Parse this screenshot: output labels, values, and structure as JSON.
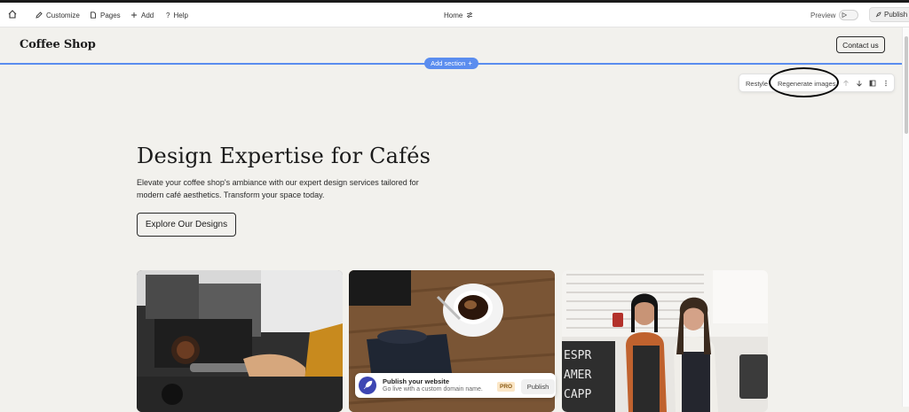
{
  "editor": {
    "nav": {
      "customize": "Customize",
      "pages": "Pages",
      "add": "Add",
      "help": "Help"
    },
    "current_page": "Home",
    "preview_label": "Preview",
    "publish_label": "Publish",
    "add_section_label": "Add section",
    "toolbar": {
      "restyle": "Restyle",
      "regenerate_images": "Regenerate images"
    }
  },
  "site": {
    "logo": "Coffee Shop",
    "contact_button": "Contact us",
    "hero": {
      "title": "Design Expertise for Cafés",
      "description": "Elevate your coffee shop's ambiance with our expert design services tailored for modern café aesthetics. Transform your space today.",
      "cta": "Explore Our Designs"
    }
  },
  "toast": {
    "title": "Publish your website",
    "subtitle": "Go live with a custom domain name.",
    "badge": "PRO",
    "button": "Publish"
  },
  "icons": {
    "home": "home-icon",
    "customize": "pen-icon",
    "pages": "page-icon",
    "add": "plus-icon",
    "help": "question-icon",
    "page_settings": "sliders-icon",
    "preview": "play-icon",
    "publish": "rocket-icon"
  },
  "colors": {
    "accent": "#5b8def",
    "background": "#f2f1ed",
    "pro_badge": "#fbe6c6"
  }
}
